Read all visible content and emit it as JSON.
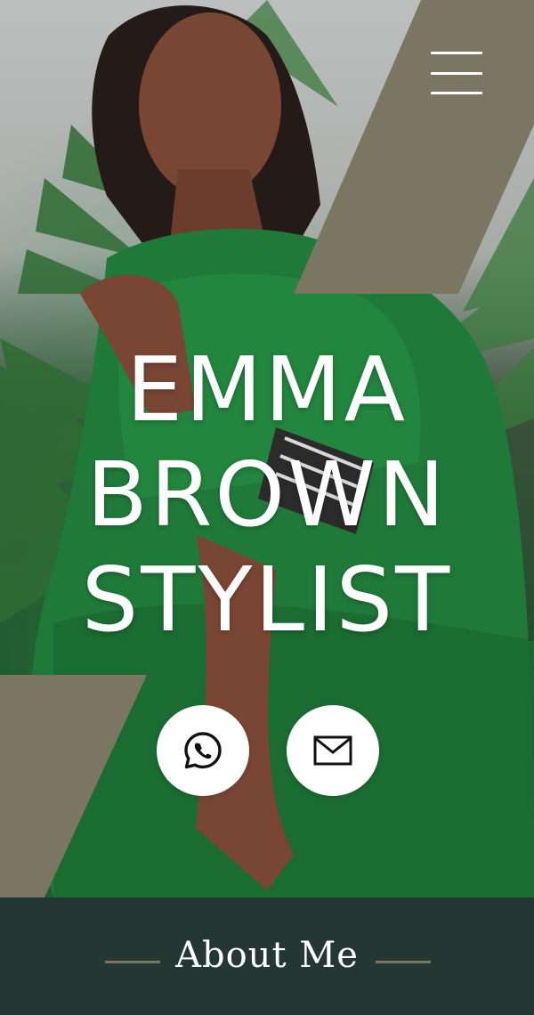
{
  "hero": {
    "headline": [
      "EMMA",
      "BROWN",
      "STYLIST"
    ]
  },
  "icons": {
    "menu": "hamburger-menu-icon",
    "whatsapp": "whatsapp-icon",
    "email": "envelope-icon"
  },
  "colors": {
    "accent_shape": "#7a7661",
    "footer_bg": "#243733",
    "dress_green": "#1f7a3a",
    "text": "#ffffff"
  },
  "about": {
    "title": "About Me"
  }
}
